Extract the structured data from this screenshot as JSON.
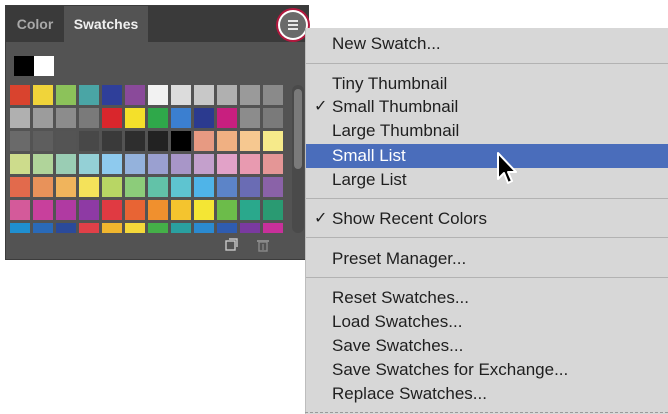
{
  "tabs": [
    {
      "label": "Color"
    },
    {
      "label": "Swatches"
    }
  ],
  "recent_colors": [
    "#000000",
    "#ffffff"
  ],
  "swatches": [
    "#d9432e",
    "#f0d43a",
    "#8cc25a",
    "#4aa5a5",
    "#2f3f9a",
    "#8a4a9a",
    "#f2f2f2",
    "#dcdcdc",
    "#c8c8c8",
    "#b0b0b0",
    "#9a9a9a",
    "#8a8a8a",
    "#b0b0b0",
    "#9c9c9c",
    "#8c8c8c",
    "#7a7a7a",
    "#d9262c",
    "#f4e02a",
    "#2fa84a",
    "#3b7fd0",
    "#2b3a8f",
    "#c81f7f",
    "#8c8c8c",
    "#7a7a7a",
    "#6a6a6a",
    "#5e5e5e",
    "#545454",
    "#484848",
    "#3a3a3a",
    "#2e2e2e",
    "#222222",
    "#000000",
    "#e79a82",
    "#f0b082",
    "#f6c890",
    "#f6ea8a",
    "#cddc8c",
    "#b0d49a",
    "#9acdb4",
    "#94d0d6",
    "#8ecaee",
    "#94b2dc",
    "#9aa0d0",
    "#a896c8",
    "#c4a0cc",
    "#e2a2c8",
    "#e89ab0",
    "#e49696",
    "#e26a4c",
    "#e8925a",
    "#f0b45c",
    "#f4e25a",
    "#b8d664",
    "#8ccc7a",
    "#62c2a8",
    "#5ec4d0",
    "#4fb4e8",
    "#5c84c8",
    "#6a6cb4",
    "#8a62a8",
    "#d45a9a",
    "#c8409c",
    "#b03aa2",
    "#8e3aa4",
    "#e03a42",
    "#e86434",
    "#f0902e",
    "#f4c42e",
    "#f4e634",
    "#6cbc4a",
    "#2aa88c",
    "#2a9a72",
    "#1f8fd0",
    "#2a6ab8",
    "#2b4a9a",
    "#e04048",
    "#f0b62e",
    "#f4d83a",
    "#44b048",
    "#2aa0a0",
    "#2b8ad0",
    "#2f5cb0",
    "#7a3aa0",
    "#c8309a"
  ],
  "menu": {
    "items": [
      {
        "label": "New Swatch...",
        "checked": false,
        "active": false
      },
      {
        "label": "Tiny Thumbnail",
        "checked": false,
        "active": false
      },
      {
        "label": "Small Thumbnail",
        "checked": true,
        "active": false
      },
      {
        "label": "Large Thumbnail",
        "checked": false,
        "active": false
      },
      {
        "label": "Small List",
        "checked": false,
        "active": true
      },
      {
        "label": "Large List",
        "checked": false,
        "active": false
      },
      {
        "label": "Show Recent Colors",
        "checked": true,
        "active": false
      },
      {
        "label": "Preset Manager...",
        "checked": false,
        "active": false
      },
      {
        "label": "Reset Swatches...",
        "checked": false,
        "active": false
      },
      {
        "label": "Load Swatches...",
        "checked": false,
        "active": false
      },
      {
        "label": "Save Swatches...",
        "checked": false,
        "active": false
      },
      {
        "label": "Save Swatches for Exchange...",
        "checked": false,
        "active": false
      },
      {
        "label": "Replace Swatches...",
        "checked": false,
        "active": false
      }
    ],
    "check_glyph": "✓"
  },
  "colors": {
    "highlight": "#4a6dbb",
    "menu_bg": "#d7d7d7",
    "panel_bg": "#535353",
    "focus_ring": "#b2183e"
  },
  "icons": [
    "panel-menu-icon",
    "new-swatch-icon",
    "trash-icon",
    "check-icon",
    "mouse-pointer-icon"
  ]
}
